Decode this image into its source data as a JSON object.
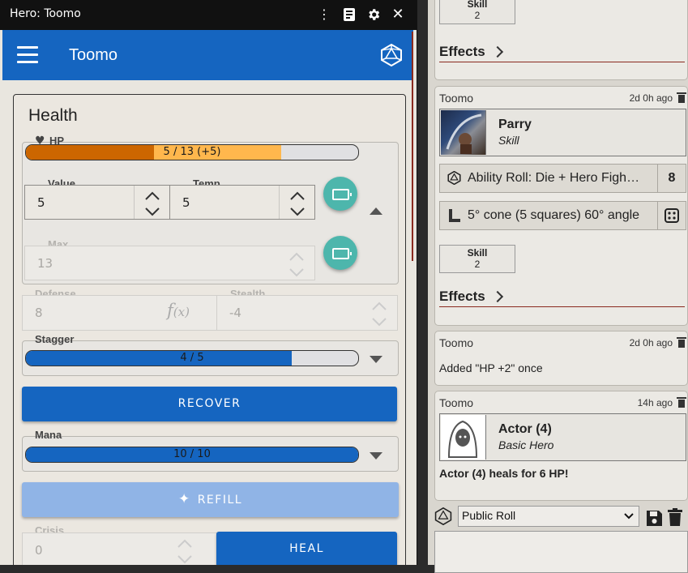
{
  "window": {
    "title": "Hero: Toomo"
  },
  "appbar": {
    "name": "Toomo"
  },
  "health": {
    "heading": "Health",
    "hp": {
      "label": "HP",
      "bar_text": "5 / 13 (+5)",
      "value_fraction": 0.3846,
      "temp_fraction": 0.7692,
      "value_color": "#cc6600",
      "temp_color": "#ffb74d"
    },
    "value": {
      "label": "Value",
      "val": "5"
    },
    "temp": {
      "label": "Temp",
      "val": "5"
    },
    "max": {
      "label": "Max",
      "val": "13"
    },
    "defense": {
      "label": "Defense",
      "val": "8"
    },
    "stealth": {
      "label": "Stealth",
      "val": "-4"
    },
    "stagger": {
      "label": "Stagger",
      "bar_text": "4 / 5",
      "fraction": 0.8,
      "color": "#1565c0"
    },
    "recover_label": "RECOVER",
    "mana": {
      "label": "Mana",
      "bar_text": "10 / 10",
      "fraction": 1.0,
      "color": "#1565c0"
    },
    "refill_label": "REFILL",
    "crisis": {
      "label": "Crisis",
      "val": "0"
    },
    "heal_label": "HEAL"
  },
  "chat": {
    "top_skill": {
      "label": "Skill",
      "value": "2"
    },
    "effects_label": "Effects",
    "messages": [
      {
        "sender": "Toomo",
        "time": "2d 0h ago",
        "item": {
          "name": "Parry",
          "type": "Skill"
        },
        "roll": {
          "text": "Ability Roll: Die + Hero Figh…",
          "result": "8"
        },
        "area": {
          "text": "5° cone (5 squares) 60° angle"
        },
        "skill": {
          "label": "Skill",
          "value": "2"
        },
        "effects_label": "Effects"
      },
      {
        "sender": "Toomo",
        "time": "2d 0h ago",
        "text": "Added \"HP +2\" once"
      },
      {
        "sender": "Toomo",
        "time": "14h ago",
        "item": {
          "name": "Actor (4)",
          "type": "Basic Hero"
        },
        "text": "Actor (4) heals for 6 HP!"
      }
    ],
    "roll_mode": "Public Roll"
  },
  "colors": {
    "accent": "#1565c0",
    "teal": "#4db6ac",
    "refill": "#90b4e6"
  }
}
